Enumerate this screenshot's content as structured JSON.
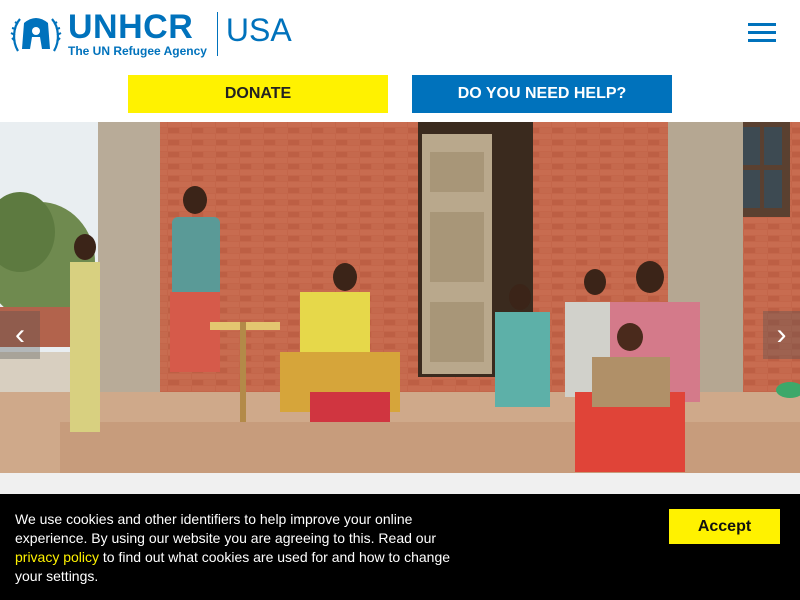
{
  "header": {
    "logo": {
      "main": "UNHCR",
      "sub": "The UN Refugee Agency",
      "country": "USA"
    },
    "menu_icon": "hamburger-menu-icon"
  },
  "actions": {
    "donate_label": "DONATE",
    "help_label": "DO YOU NEED HELP?"
  },
  "hero": {
    "prev_icon": "chevron-left-icon",
    "next_icon": "chevron-right-icon",
    "prev_glyph": "‹",
    "next_glyph": "›"
  },
  "cookie_banner": {
    "text_before": "We use cookies and other identifiers to help improve your online experience. By using our website you are agreeing to this. Read our",
    "link_text": "privacy policy",
    "text_after": "to find out what cookies are used for and how to change your settings.",
    "accept_label": "Accept"
  },
  "colors": {
    "brand_blue": "#0072bc",
    "donate_yellow": "#fff200",
    "cookie_bg": "#000000"
  }
}
